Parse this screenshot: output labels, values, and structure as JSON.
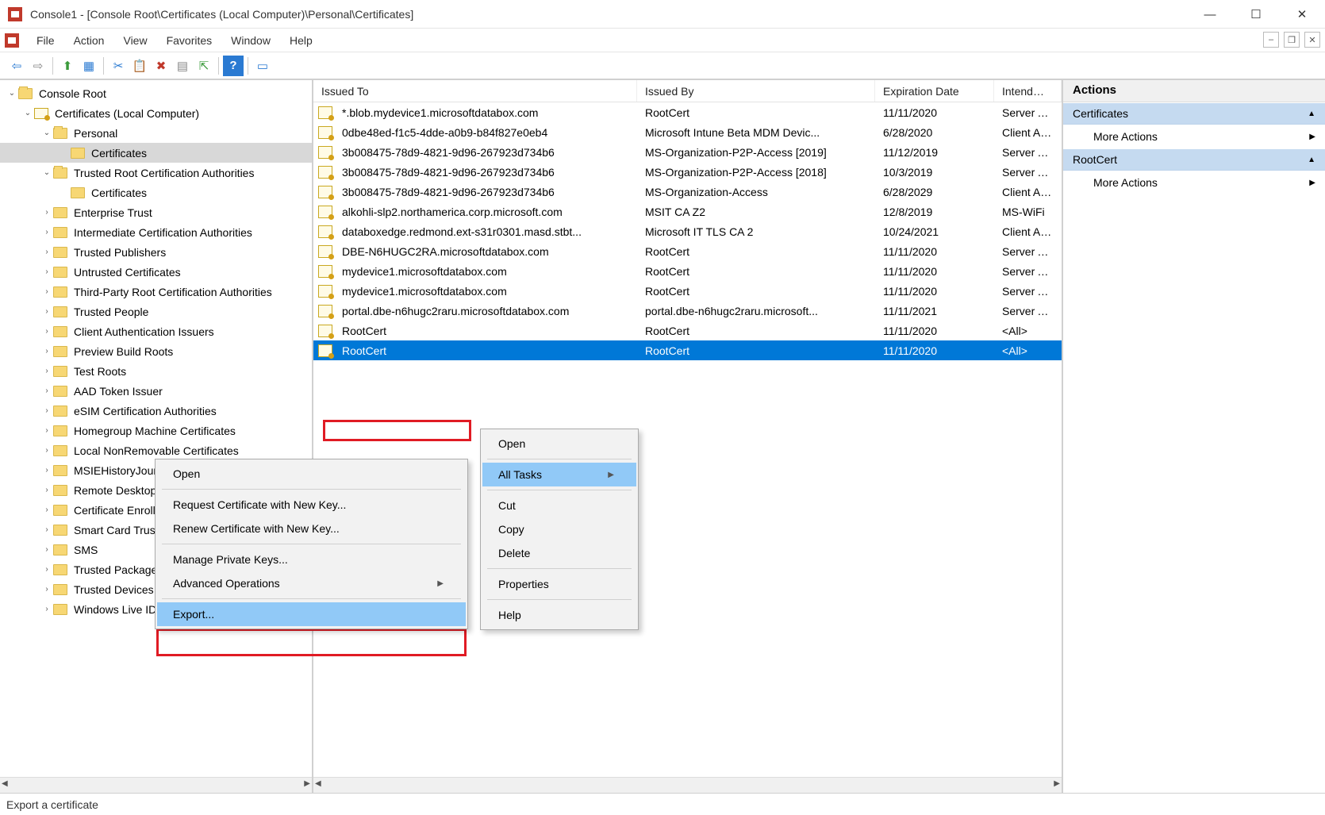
{
  "window": {
    "title": "Console1 - [Console Root\\Certificates (Local Computer)\\Personal\\Certificates]"
  },
  "menu": {
    "items": [
      "File",
      "Action",
      "View",
      "Favorites",
      "Window",
      "Help"
    ]
  },
  "toolbar_icons": [
    "⇦",
    "⇨",
    "⬆",
    "🗔",
    "✂",
    "📋",
    "✖",
    "🗐",
    "📤",
    "❔",
    "📑"
  ],
  "tree": {
    "nodes": [
      {
        "label": "Console Root",
        "indent": 0,
        "twisty": "v",
        "type": "folder",
        "open": true
      },
      {
        "label": "Certificates (Local Computer)",
        "indent": 1,
        "twisty": "v",
        "type": "cert",
        "open": true
      },
      {
        "label": "Personal",
        "indent": 2,
        "twisty": "v",
        "type": "folder",
        "open": true
      },
      {
        "label": "Certificates",
        "indent": 3,
        "twisty": "",
        "type": "folder",
        "selected": true
      },
      {
        "label": "Trusted Root Certification Authorities",
        "indent": 2,
        "twisty": "v",
        "type": "folder",
        "open": true
      },
      {
        "label": "Certificates",
        "indent": 3,
        "twisty": "",
        "type": "folder"
      },
      {
        "label": "Enterprise Trust",
        "indent": 2,
        "twisty": ">",
        "type": "folder"
      },
      {
        "label": "Intermediate Certification Authorities",
        "indent": 2,
        "twisty": ">",
        "type": "folder"
      },
      {
        "label": "Trusted Publishers",
        "indent": 2,
        "twisty": ">",
        "type": "folder"
      },
      {
        "label": "Untrusted Certificates",
        "indent": 2,
        "twisty": ">",
        "type": "folder"
      },
      {
        "label": "Third-Party Root Certification Authorities",
        "indent": 2,
        "twisty": ">",
        "type": "folder"
      },
      {
        "label": "Trusted People",
        "indent": 2,
        "twisty": ">",
        "type": "folder"
      },
      {
        "label": "Client Authentication Issuers",
        "indent": 2,
        "twisty": ">",
        "type": "folder"
      },
      {
        "label": "Preview Build Roots",
        "indent": 2,
        "twisty": ">",
        "type": "folder"
      },
      {
        "label": "Test Roots",
        "indent": 2,
        "twisty": ">",
        "type": "folder"
      },
      {
        "label": "AAD Token Issuer",
        "indent": 2,
        "twisty": ">",
        "type": "folder"
      },
      {
        "label": "eSIM Certification Authorities",
        "indent": 2,
        "twisty": ">",
        "type": "folder"
      },
      {
        "label": "Homegroup Machine Certificates",
        "indent": 2,
        "twisty": ">",
        "type": "folder"
      },
      {
        "label": "Local NonRemovable Certificates",
        "indent": 2,
        "twisty": ">",
        "type": "folder"
      },
      {
        "label": "MSIEHistoryJournal",
        "indent": 2,
        "twisty": ">",
        "type": "folder"
      },
      {
        "label": "Remote Desktop",
        "indent": 2,
        "twisty": ">",
        "type": "folder"
      },
      {
        "label": "Certificate Enrollment Requests",
        "indent": 2,
        "twisty": ">",
        "type": "folder"
      },
      {
        "label": "Smart Card Trusted Roots",
        "indent": 2,
        "twisty": ">",
        "type": "folder"
      },
      {
        "label": "SMS",
        "indent": 2,
        "twisty": ">",
        "type": "folder"
      },
      {
        "label": "Trusted Packaged App Installation Authorities",
        "indent": 2,
        "twisty": ">",
        "type": "folder"
      },
      {
        "label": "Trusted Devices",
        "indent": 2,
        "twisty": ">",
        "type": "folder"
      },
      {
        "label": "Windows Live ID Token Issuer",
        "indent": 2,
        "twisty": ">",
        "type": "folder"
      }
    ]
  },
  "list": {
    "columns": {
      "issued_to": "Issued To",
      "issued_by": "Issued By",
      "exp": "Expiration Date",
      "intended": "Intended Purposes"
    },
    "rows": [
      {
        "issued_to": "*.blob.mydevice1.microsoftdatabox.com",
        "issued_by": "RootCert",
        "exp": "11/11/2020",
        "intended": "Server Authentication"
      },
      {
        "issued_to": "0dbe48ed-f1c5-4dde-a0b9-b84f827e0eb4",
        "issued_by": "Microsoft Intune Beta MDM Devic...",
        "exp": "6/28/2020",
        "intended": "Client Authentication"
      },
      {
        "issued_to": "3b008475-78d9-4821-9d96-267923d734b6",
        "issued_by": "MS-Organization-P2P-Access [2019]",
        "exp": "11/12/2019",
        "intended": "Server Authentication"
      },
      {
        "issued_to": "3b008475-78d9-4821-9d96-267923d734b6",
        "issued_by": "MS-Organization-P2P-Access [2018]",
        "exp": "10/3/2019",
        "intended": "Server Authentication"
      },
      {
        "issued_to": "3b008475-78d9-4821-9d96-267923d734b6",
        "issued_by": "MS-Organization-Access",
        "exp": "6/28/2029",
        "intended": "Client Authentication"
      },
      {
        "issued_to": "alkohli-slp2.northamerica.corp.microsoft.com",
        "issued_by": "MSIT CA Z2",
        "exp": "12/8/2019",
        "intended": "MS-WiFi"
      },
      {
        "issued_to": "databoxedge.redmond.ext-s31r0301.masd.stbt...",
        "issued_by": "Microsoft IT TLS CA 2",
        "exp": "10/24/2021",
        "intended": "Client Authentication"
      },
      {
        "issued_to": "DBE-N6HUGC2RA.microsoftdatabox.com",
        "issued_by": "RootCert",
        "exp": "11/11/2020",
        "intended": "Server Authentication"
      },
      {
        "issued_to": "mydevice1.microsoftdatabox.com",
        "issued_by": "RootCert",
        "exp": "11/11/2020",
        "intended": "Server Authentication"
      },
      {
        "issued_to": "mydevice1.microsoftdatabox.com",
        "issued_by": "RootCert",
        "exp": "11/11/2020",
        "intended": "Server Authentication"
      },
      {
        "issued_to": "portal.dbe-n6hugc2raru.microsoftdatabox.com",
        "issued_by": "portal.dbe-n6hugc2raru.microsoft...",
        "exp": "11/11/2021",
        "intended": "Server Authentication"
      },
      {
        "issued_to": "RootCert",
        "issued_by": "RootCert",
        "exp": "11/11/2020",
        "intended": "<All>"
      },
      {
        "issued_to": "RootCert",
        "issued_by": "RootCert",
        "exp": "11/11/2020",
        "intended": "<All>",
        "selected": true
      }
    ]
  },
  "ctx1": {
    "items": [
      {
        "label": "Open",
        "sep_after": true
      },
      {
        "label": "All Tasks",
        "arrow": true,
        "highlight": true,
        "sep_after": true
      },
      {
        "label": "Cut"
      },
      {
        "label": "Copy"
      },
      {
        "label": "Delete",
        "sep_after": true
      },
      {
        "label": "Properties",
        "sep_after": true
      },
      {
        "label": "Help"
      }
    ]
  },
  "ctx2": {
    "items": [
      {
        "label": "Open",
        "sep_after": true
      },
      {
        "label": "Request Certificate with New Key..."
      },
      {
        "label": "Renew Certificate with New Key...",
        "sep_after": true
      },
      {
        "label": "Manage Private Keys..."
      },
      {
        "label": "Advanced Operations",
        "arrow": true,
        "sep_after": true
      },
      {
        "label": "Export...",
        "highlight": true
      }
    ]
  },
  "actions": {
    "title": "Actions",
    "sections": [
      {
        "header": "Certificates",
        "items": [
          {
            "label": "More Actions",
            "arrow": true
          }
        ]
      },
      {
        "header": "RootCert",
        "items": [
          {
            "label": "More Actions",
            "arrow": true
          }
        ]
      }
    ]
  },
  "status": {
    "text": "Export a certificate"
  }
}
